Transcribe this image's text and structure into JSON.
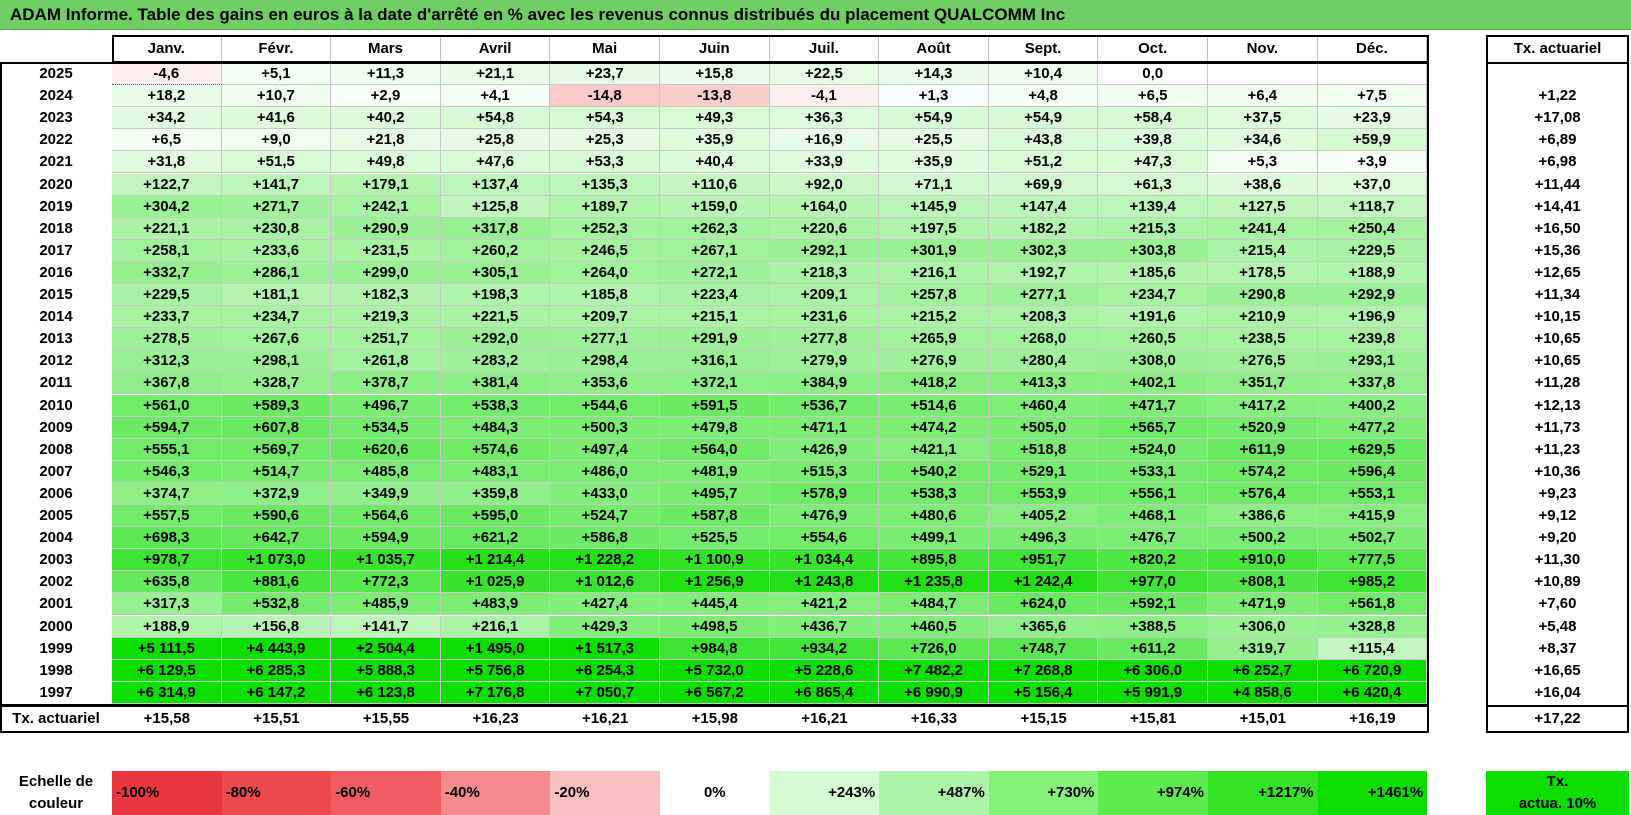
{
  "title": "ADAM Informe. Table des gains en euros à la date d'arrêté en % avec les revenus connus distribués du placement QUALCOMM Inc",
  "chart_data": {
    "type": "heatmap",
    "columns": [
      "Janv.",
      "Févr.",
      "Mars",
      "Avril",
      "Mai",
      "Juin",
      "Juil.",
      "Août",
      "Sept.",
      "Oct.",
      "Nov.",
      "Déc."
    ],
    "rate_header": "Tx. actuariel",
    "rows": [
      {
        "year": "2025",
        "values": [
          "-4,6",
          "+5,1",
          "+11,3",
          "+21,1",
          "+23,7",
          "+15,8",
          "+22,5",
          "+14,3",
          "+10,4",
          "0,0",
          "",
          ""
        ],
        "rate": ""
      },
      {
        "year": "2024",
        "values": [
          "+18,2",
          "+10,7",
          "+2,9",
          "+4,1",
          "-14,8",
          "-13,8",
          "-4,1",
          "+1,3",
          "+4,8",
          "+6,5",
          "+6,4",
          "+7,5"
        ],
        "rate": "+1,22"
      },
      {
        "year": "2023",
        "values": [
          "+34,2",
          "+41,6",
          "+40,2",
          "+54,8",
          "+54,3",
          "+49,3",
          "+36,3",
          "+54,9",
          "+54,9",
          "+58,4",
          "+37,5",
          "+23,9"
        ],
        "rate": "+17,08"
      },
      {
        "year": "2022",
        "values": [
          "+6,5",
          "+9,0",
          "+21,8",
          "+25,8",
          "+25,3",
          "+35,9",
          "+16,9",
          "+25,5",
          "+43,8",
          "+39,8",
          "+34,6",
          "+59,9"
        ],
        "rate": "+6,89"
      },
      {
        "year": "2021",
        "values": [
          "+31,8",
          "+51,5",
          "+49,8",
          "+47,6",
          "+53,3",
          "+40,4",
          "+33,9",
          "+35,9",
          "+51,2",
          "+47,3",
          "+5,3",
          "+3,9"
        ],
        "rate": "+6,98"
      },
      {
        "year": "2020",
        "values": [
          "+122,7",
          "+141,7",
          "+179,1",
          "+137,4",
          "+135,3",
          "+110,6",
          "+92,0",
          "+71,1",
          "+69,9",
          "+61,3",
          "+38,6",
          "+37,0"
        ],
        "rate": "+11,44"
      },
      {
        "year": "2019",
        "values": [
          "+304,2",
          "+271,7",
          "+242,1",
          "+125,8",
          "+189,7",
          "+159,0",
          "+164,0",
          "+145,9",
          "+147,4",
          "+139,4",
          "+127,5",
          "+118,7"
        ],
        "rate": "+14,41"
      },
      {
        "year": "2018",
        "values": [
          "+221,1",
          "+230,8",
          "+290,9",
          "+317,8",
          "+252,3",
          "+262,3",
          "+220,6",
          "+197,5",
          "+182,2",
          "+215,3",
          "+241,4",
          "+250,4"
        ],
        "rate": "+16,50"
      },
      {
        "year": "2017",
        "values": [
          "+258,1",
          "+233,6",
          "+231,5",
          "+260,2",
          "+246,5",
          "+267,1",
          "+292,1",
          "+301,9",
          "+302,3",
          "+303,8",
          "+215,4",
          "+229,5"
        ],
        "rate": "+15,36"
      },
      {
        "year": "2016",
        "values": [
          "+332,7",
          "+286,1",
          "+299,0",
          "+305,1",
          "+264,0",
          "+272,1",
          "+218,3",
          "+216,1",
          "+192,7",
          "+185,6",
          "+178,5",
          "+188,9"
        ],
        "rate": "+12,65"
      },
      {
        "year": "2015",
        "values": [
          "+229,5",
          "+181,1",
          "+182,3",
          "+198,3",
          "+185,8",
          "+223,4",
          "+209,1",
          "+257,8",
          "+277,1",
          "+234,7",
          "+290,8",
          "+292,9"
        ],
        "rate": "+11,34"
      },
      {
        "year": "2014",
        "values": [
          "+233,7",
          "+234,7",
          "+219,3",
          "+221,5",
          "+209,7",
          "+215,1",
          "+231,6",
          "+215,2",
          "+208,3",
          "+191,6",
          "+210,9",
          "+196,9"
        ],
        "rate": "+10,15"
      },
      {
        "year": "2013",
        "values": [
          "+278,5",
          "+267,6",
          "+251,7",
          "+292,0",
          "+277,1",
          "+291,9",
          "+277,8",
          "+265,9",
          "+268,0",
          "+260,5",
          "+238,5",
          "+239,8"
        ],
        "rate": "+10,65"
      },
      {
        "year": "2012",
        "values": [
          "+312,3",
          "+298,1",
          "+261,8",
          "+283,2",
          "+298,4",
          "+316,1",
          "+279,9",
          "+276,9",
          "+280,4",
          "+308,0",
          "+276,5",
          "+293,1"
        ],
        "rate": "+10,65"
      },
      {
        "year": "2011",
        "values": [
          "+367,8",
          "+328,7",
          "+378,7",
          "+381,4",
          "+353,6",
          "+372,1",
          "+384,9",
          "+418,2",
          "+413,3",
          "+402,1",
          "+351,7",
          "+337,8"
        ],
        "rate": "+11,28"
      },
      {
        "year": "2010",
        "values": [
          "+561,0",
          "+589,3",
          "+496,7",
          "+538,3",
          "+544,6",
          "+591,5",
          "+536,7",
          "+514,6",
          "+460,4",
          "+471,7",
          "+417,2",
          "+400,2"
        ],
        "rate": "+12,13"
      },
      {
        "year": "2009",
        "values": [
          "+594,7",
          "+607,8",
          "+534,5",
          "+484,3",
          "+500,3",
          "+479,8",
          "+471,1",
          "+474,2",
          "+505,0",
          "+565,7",
          "+520,9",
          "+477,2"
        ],
        "rate": "+11,73"
      },
      {
        "year": "2008",
        "values": [
          "+555,1",
          "+569,7",
          "+620,6",
          "+574,6",
          "+497,4",
          "+564,0",
          "+426,9",
          "+421,1",
          "+518,8",
          "+524,0",
          "+611,9",
          "+629,5"
        ],
        "rate": "+11,23"
      },
      {
        "year": "2007",
        "values": [
          "+546,3",
          "+514,7",
          "+485,8",
          "+483,1",
          "+486,0",
          "+481,9",
          "+515,3",
          "+540,2",
          "+529,1",
          "+533,1",
          "+574,2",
          "+596,4"
        ],
        "rate": "+10,36"
      },
      {
        "year": "2006",
        "values": [
          "+374,7",
          "+372,9",
          "+349,9",
          "+359,8",
          "+433,0",
          "+495,7",
          "+578,9",
          "+538,3",
          "+553,9",
          "+556,1",
          "+576,4",
          "+553,1"
        ],
        "rate": "+9,23"
      },
      {
        "year": "2005",
        "values": [
          "+557,5",
          "+590,6",
          "+564,6",
          "+595,0",
          "+524,7",
          "+587,8",
          "+476,9",
          "+480,6",
          "+405,2",
          "+468,1",
          "+386,6",
          "+415,9"
        ],
        "rate": "+9,12"
      },
      {
        "year": "2004",
        "values": [
          "+698,3",
          "+642,7",
          "+594,9",
          "+621,2",
          "+586,8",
          "+525,5",
          "+554,6",
          "+499,1",
          "+496,3",
          "+476,7",
          "+500,2",
          "+502,7"
        ],
        "rate": "+9,20"
      },
      {
        "year": "2003",
        "values": [
          "+978,7",
          "+1 073,0",
          "+1 035,7",
          "+1 214,4",
          "+1 228,2",
          "+1 100,9",
          "+1 034,4",
          "+895,8",
          "+951,7",
          "+820,2",
          "+910,0",
          "+777,5"
        ],
        "rate": "+11,30"
      },
      {
        "year": "2002",
        "values": [
          "+635,8",
          "+881,6",
          "+772,3",
          "+1 025,9",
          "+1 012,6",
          "+1 256,9",
          "+1 243,8",
          "+1 235,8",
          "+1 242,4",
          "+977,0",
          "+808,1",
          "+985,2"
        ],
        "rate": "+10,89"
      },
      {
        "year": "2001",
        "values": [
          "+317,3",
          "+532,8",
          "+485,9",
          "+483,9",
          "+427,4",
          "+445,4",
          "+421,2",
          "+484,7",
          "+624,0",
          "+592,1",
          "+471,9",
          "+561,8"
        ],
        "rate": "+7,60"
      },
      {
        "year": "2000",
        "values": [
          "+188,9",
          "+156,8",
          "+141,7",
          "+216,1",
          "+429,3",
          "+498,5",
          "+436,7",
          "+460,5",
          "+365,6",
          "+388,5",
          "+306,0",
          "+328,8"
        ],
        "rate": "+5,48"
      },
      {
        "year": "1999",
        "values": [
          "+5 111,5",
          "+4 443,9",
          "+2 504,4",
          "+1 495,0",
          "+1 517,3",
          "+984,8",
          "+934,2",
          "+726,0",
          "+748,7",
          "+611,2",
          "+319,7",
          "+115,4"
        ],
        "rate": "+8,37"
      },
      {
        "year": "1998",
        "values": [
          "+6 129,5",
          "+6 285,3",
          "+5 888,3",
          "+5 756,8",
          "+6 254,3",
          "+5 732,0",
          "+5 228,6",
          "+7 482,2",
          "+7 268,8",
          "+6 306,0",
          "+6 252,7",
          "+6 720,9"
        ],
        "rate": "+16,65"
      },
      {
        "year": "1997",
        "values": [
          "+6 314,9",
          "+6 147,2",
          "+6 123,8",
          "+7 176,8",
          "+7 050,7",
          "+6 567,2",
          "+6 865,4",
          "+6 990,9",
          "+5 156,4",
          "+5 991,9",
          "+4 858,6",
          "+6 420,4"
        ],
        "rate": "+16,04"
      }
    ],
    "footer": {
      "label": "Tx. actuariel",
      "values": [
        "+15,58",
        "+15,51",
        "+15,55",
        "+16,23",
        "+16,21",
        "+15,98",
        "+16,21",
        "+16,33",
        "+15,15",
        "+15,81",
        "+15,01",
        "+16,19"
      ],
      "rate": "+17,22"
    },
    "legend": {
      "label_line1": "Echelle de",
      "label_line2": "couleur",
      "steps": [
        {
          "text": "-100%",
          "color": "#e8383d"
        },
        {
          "text": "-80%",
          "color": "#ec4a4f"
        },
        {
          "text": "-60%",
          "color": "#f05c61"
        },
        {
          "text": "-40%",
          "color": "#f38b8e"
        },
        {
          "text": "-20%",
          "color": "#f9bfc1"
        },
        {
          "text": "0%",
          "color": "#ffffff"
        },
        {
          "text": "+243%",
          "color": "#d6fbd3"
        },
        {
          "text": "+487%",
          "color": "#adf5a6"
        },
        {
          "text": "+730%",
          "color": "#85f07a"
        },
        {
          "text": "+974%",
          "color": "#5cea4e"
        },
        {
          "text": "+1217%",
          "color": "#33e324"
        },
        {
          "text": "+1461%",
          "color": "#0edd00"
        }
      ],
      "rate_label_line1": "Tx.",
      "rate_label_line2": "actua. 10%",
      "rate_color": "#0edd00"
    }
  }
}
